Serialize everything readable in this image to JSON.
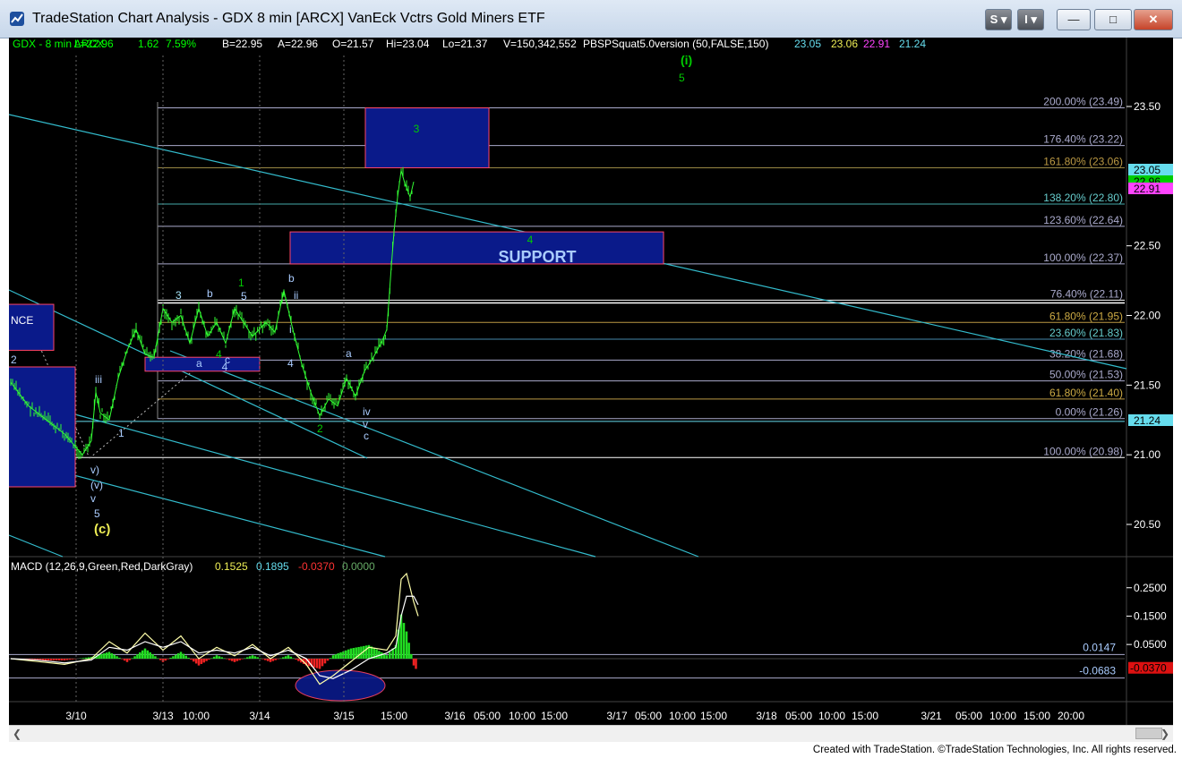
{
  "window": {
    "title": "TradeStation Chart Analysis - GDX 8 min [ARCX] VanEck Vctrs Gold Miners ETF",
    "buttons": {
      "s": "S",
      "i": "I",
      "minimize": "—",
      "maximize": "□",
      "close": "✕"
    }
  },
  "header": [
    {
      "text": "GDX - 8 min   ARCX",
      "color": "#00ff00"
    },
    {
      "text": "L=22.96",
      "color": "#00ff00"
    },
    {
      "text": "1.62",
      "color": "#00ff00"
    },
    {
      "text": "7.59%",
      "color": "#00ff00"
    },
    {
      "text": "B=22.95",
      "color": "#ffffff"
    },
    {
      "text": "A=22.96",
      "color": "#ffffff"
    },
    {
      "text": "O=21.57",
      "color": "#ffffff"
    },
    {
      "text": "Hi=23.04",
      "color": "#ffffff"
    },
    {
      "text": "Lo=21.37",
      "color": "#ffffff"
    },
    {
      "text": "V=150,342,552",
      "color": "#ffffff"
    },
    {
      "text": "PBSPSquat5.0version (50,FALSE,150)",
      "color": "#ffffff"
    },
    {
      "text": "23.05",
      "color": "#66ddee"
    },
    {
      "text": "23.06",
      "color": "#eeee55"
    },
    {
      "text": "22.91",
      "color": "#ff44ff"
    },
    {
      "text": "21.24",
      "color": "#66ddee"
    }
  ],
  "macd_header": [
    {
      "text": "MACD (12,26,9,Green,Red,DarkGray)",
      "color": "#ffffff"
    },
    {
      "text": "0.1525",
      "color": "#eeee55"
    },
    {
      "text": "0.1895",
      "color": "#66ddee"
    },
    {
      "text": "-0.0370",
      "color": "#ff3333"
    },
    {
      "text": "0.0000",
      "color": "#66aa66"
    }
  ],
  "chart_data": [
    {
      "type": "candlestick",
      "symbol": "GDX 8 min",
      "ylim": [
        20.2,
        23.85
      ],
      "y_ticks": [
        20.5,
        21.0,
        21.5,
        22.0,
        22.5,
        23.5
      ],
      "x_tick_labels": [
        "3/10",
        "3/13",
        "10:00",
        "3/14",
        "3/15",
        "15:00",
        "3/16",
        "05:00",
        "10:00",
        "15:00",
        "3/17",
        "05:00",
        "10:00",
        "15:00",
        "3/18",
        "05:00",
        "10:00",
        "15:00",
        "3/21",
        "05:00",
        "10:00",
        "15:00",
        "20:00"
      ],
      "price_path": [
        [
          0,
          21.52
        ],
        [
          20,
          21.35
        ],
        [
          40,
          21.25
        ],
        [
          60,
          21.15
        ],
        [
          80,
          21.0
        ],
        [
          90,
          21.1
        ],
        [
          95,
          21.45
        ],
        [
          100,
          21.3
        ],
        [
          110,
          21.25
        ],
        [
          120,
          21.55
        ],
        [
          130,
          21.75
        ],
        [
          140,
          21.9
        ],
        [
          150,
          21.72
        ],
        [
          160,
          21.7
        ],
        [
          170,
          22.05
        ],
        [
          180,
          21.95
        ],
        [
          190,
          22.0
        ],
        [
          200,
          21.8
        ],
        [
          210,
          22.05
        ],
        [
          220,
          21.85
        ],
        [
          230,
          21.95
        ],
        [
          240,
          21.8
        ],
        [
          250,
          22.05
        ],
        [
          260,
          21.95
        ],
        [
          270,
          21.85
        ],
        [
          285,
          21.95
        ],
        [
          295,
          21.88
        ],
        [
          305,
          22.18
        ],
        [
          315,
          21.9
        ],
        [
          325,
          21.65
        ],
        [
          335,
          21.45
        ],
        [
          345,
          21.28
        ],
        [
          355,
          21.4
        ],
        [
          365,
          21.35
        ],
        [
          375,
          21.55
        ],
        [
          385,
          21.42
        ],
        [
          395,
          21.6
        ],
        [
          405,
          21.7
        ],
        [
          415,
          21.82
        ],
        [
          420,
          21.9
        ],
        [
          425,
          22.35
        ],
        [
          428,
          22.6
        ],
        [
          432,
          22.85
        ],
        [
          436,
          23.04
        ],
        [
          440,
          22.95
        ],
        [
          446,
          22.85
        ],
        [
          450,
          22.96
        ]
      ],
      "price_labels": [
        {
          "text": "23.05",
          "bg": "#66ddee",
          "value": 23.05
        },
        {
          "text": "22.96",
          "bg": "#00cc00",
          "value": 22.96
        },
        {
          "text": "22.91",
          "bg": "#ff44ff",
          "value": 22.91
        },
        {
          "text": "21.24",
          "bg": "#66ddee",
          "value": 21.24
        }
      ],
      "fib_labels": [
        {
          "text": "200.00% (23.49)",
          "value": 23.49
        },
        {
          "text": "176.40% (23.22)",
          "value": 23.22
        },
        {
          "text": "161.80% (23.06)",
          "value": 23.06
        },
        {
          "text": "138.20% (22.80)",
          "value": 22.8
        },
        {
          "text": "123.60% (22.64)",
          "value": 22.64
        },
        {
          "text": "100.00% (22.37)",
          "value": 22.37
        },
        {
          "text": "76.40% (22.11)",
          "value": 22.11
        },
        {
          "text": "61.80% (21.95)",
          "value": 21.95
        },
        {
          "text": "23.60% (21.83)",
          "value": 21.83
        },
        {
          "text": "38.20% (21.68)",
          "value": 21.68
        },
        {
          "text": "50.00% (21.53)",
          "value": 21.53
        },
        {
          "text": "61.80% (21.40)",
          "value": 21.4
        },
        {
          "text": "0.00% (21.26)",
          "value": 21.26
        },
        {
          "text": "100.00% (20.98)",
          "value": 20.98
        }
      ],
      "boxes": [
        {
          "label": "3",
          "y_top": 23.49,
          "y_bottom": 23.06
        },
        {
          "label": "4",
          "text": "SUPPORT",
          "y_top": 22.6,
          "y_bottom": 22.37
        },
        {
          "label": "NCE",
          "y_top": 22.08,
          "y_bottom": 21.75
        },
        {
          "label": "4",
          "y_top": 21.7,
          "y_bottom": 21.6
        }
      ],
      "wave_labels": [
        {
          "text": "(i)",
          "color": "#00cc00"
        },
        {
          "text": "5",
          "color": "#00cc00"
        },
        {
          "text": "3",
          "color": "#00cc00"
        },
        {
          "text": "4",
          "color": "#00cc00"
        },
        {
          "text": "1",
          "color": "#00cc00"
        },
        {
          "text": "3",
          "color": "#aaccff"
        },
        {
          "text": "b",
          "color": "#aaccff"
        },
        {
          "text": "5",
          "color": "#aaccff"
        },
        {
          "text": "b",
          "color": "#aaccff"
        },
        {
          "text": "ii",
          "color": "#aaccff"
        },
        {
          "text": "i",
          "color": "#aaccff"
        },
        {
          "text": "a",
          "color": "#aaccff"
        },
        {
          "text": "c",
          "color": "#aaccff"
        },
        {
          "text": "4",
          "color": "#aaccff"
        },
        {
          "text": "a",
          "color": "#aaccff"
        },
        {
          "text": "iv",
          "color": "#aaccff"
        },
        {
          "text": "v",
          "color": "#aaccff"
        },
        {
          "text": "c",
          "color": "#aaccff"
        },
        {
          "text": "2",
          "color": "#00cc00"
        },
        {
          "text": "iii",
          "color": "#aaccff"
        },
        {
          "text": "1",
          "color": "#aaccff"
        },
        {
          "text": "2",
          "color": "#aaccff"
        },
        {
          "text": "v)",
          "color": "#aaccff"
        },
        {
          "text": "(v)",
          "color": "#aaccff"
        },
        {
          "text": "v",
          "color": "#aaccff"
        },
        {
          "text": "5",
          "color": "#aaccff"
        },
        {
          "text": "(c)",
          "color": "#eeee55"
        },
        {
          "text": "(2)",
          "color": "#00cc00"
        }
      ]
    },
    {
      "type": "line",
      "title": "MACD (12,26,9,Green,Red,DarkGray)",
      "y_ticks": [
        0.25,
        0.15,
        0.05
      ],
      "ref_labels": [
        {
          "text": "0.0147",
          "value": 0.0147
        },
        {
          "text": "-0.0683",
          "value": -0.0683
        }
      ],
      "last_label": {
        "text": "-0.0370",
        "value": -0.037
      },
      "series": [
        {
          "values": [
            [
              0,
              0.0
            ],
            [
              30,
              -0.01
            ],
            [
              60,
              -0.02
            ],
            [
              90,
              0.0
            ],
            [
              110,
              0.06
            ],
            [
              130,
              0.02
            ],
            [
              150,
              0.09
            ],
            [
              170,
              0.03
            ],
            [
              190,
              0.08
            ],
            [
              210,
              0.0
            ],
            [
              230,
              0.04
            ],
            [
              250,
              0.01
            ],
            [
              270,
              0.05
            ],
            [
              290,
              0.0
            ],
            [
              310,
              0.04
            ],
            [
              330,
              -0.02
            ],
            [
              345,
              -0.09
            ],
            [
              360,
              -0.06
            ],
            [
              380,
              -0.01
            ],
            [
              400,
              0.04
            ],
            [
              420,
              0.03
            ],
            [
              430,
              0.08
            ],
            [
              436,
              0.28
            ],
            [
              442,
              0.3
            ],
            [
              450,
              0.2
            ],
            [
              455,
              0.15
            ]
          ]
        },
        {
          "values": [
            [
              0,
              0.0
            ],
            [
              30,
              -0.005
            ],
            [
              60,
              -0.015
            ],
            [
              90,
              -0.005
            ],
            [
              110,
              0.04
            ],
            [
              130,
              0.03
            ],
            [
              150,
              0.06
            ],
            [
              170,
              0.04
            ],
            [
              190,
              0.06
            ],
            [
              210,
              0.02
            ],
            [
              230,
              0.03
            ],
            [
              250,
              0.02
            ],
            [
              270,
              0.04
            ],
            [
              290,
              0.01
            ],
            [
              310,
              0.03
            ],
            [
              330,
              0.0
            ],
            [
              345,
              -0.06
            ],
            [
              360,
              -0.07
            ],
            [
              380,
              -0.04
            ],
            [
              400,
              0.0
            ],
            [
              420,
              0.02
            ],
            [
              430,
              0.04
            ],
            [
              436,
              0.15
            ],
            [
              442,
              0.22
            ],
            [
              450,
              0.22
            ],
            [
              455,
              0.19
            ]
          ]
        }
      ],
      "histogram_note": "green above zero, red below zero"
    }
  ],
  "footer": "Created with TradeStation. ©TradeStation Technologies, Inc. All rights reserved."
}
